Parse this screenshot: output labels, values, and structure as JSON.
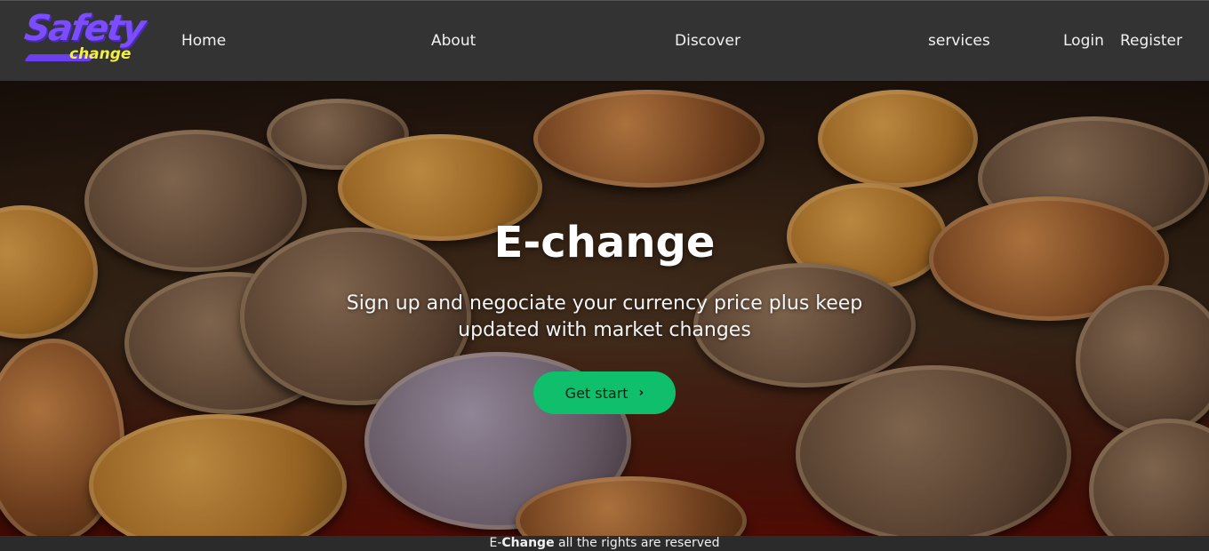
{
  "logo": {
    "main_text": "Safety",
    "sub_text": "change"
  },
  "nav": {
    "home": "Home",
    "about": "About",
    "discover": "Discover",
    "services": "services",
    "login": "Login",
    "register": "Register"
  },
  "hero": {
    "title": "E-change",
    "subtitle": "Sign up and negociate your currency price plus keep updated with market changes",
    "cta_label": "Get start",
    "cta_icon": "chevron-right-icon"
  },
  "footer": {
    "prefix": "E-",
    "brand": "Change",
    "suffix": " all the rights are reserved"
  },
  "colors": {
    "navbar_bg": "#333333",
    "cta_bg": "#0fbf6b",
    "logo_primary": "#7b4dff",
    "logo_secondary": "#f4f13a"
  }
}
